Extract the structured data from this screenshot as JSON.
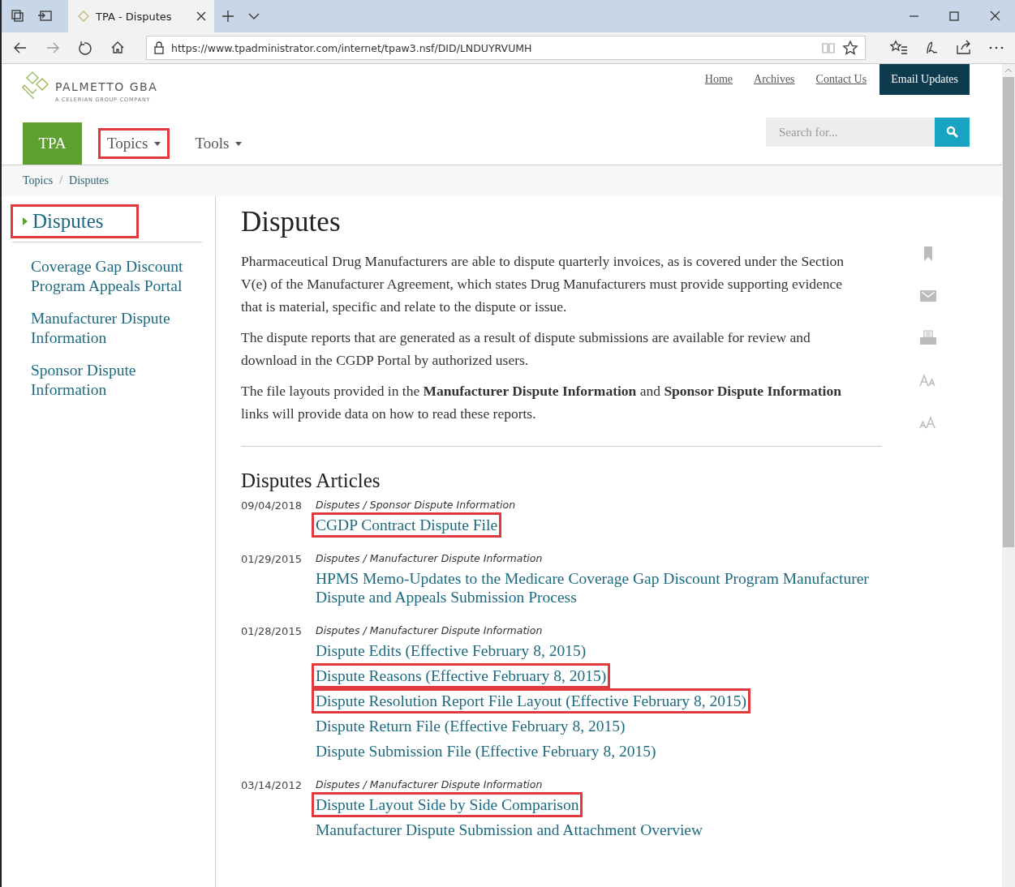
{
  "browser": {
    "tab_title": "TPA - Disputes",
    "url": "https://www.tpadministrator.com/internet/tpaw3.nsf/DID/LNDUYRVUMH"
  },
  "header": {
    "logo_name": "PALMETTO GBA",
    "logo_tagline": "A CELERIAN GROUP COMPANY",
    "utility_links": [
      "Home",
      "Archives",
      "Contact Us"
    ],
    "email_button": "Email Updates",
    "site_tab": "TPA",
    "nav": [
      {
        "label": "Topics",
        "highlighted": true
      },
      {
        "label": "Tools",
        "highlighted": false
      }
    ],
    "search": {
      "placeholder": "Search for..."
    }
  },
  "breadcrumb": [
    "Topics",
    "Disputes"
  ],
  "breadcrumb_separator": "/",
  "sidebar": {
    "heading": "Disputes",
    "highlighted": true,
    "links": [
      "Coverage Gap Discount Program Appeals Portal",
      "Manufacturer Dispute Information",
      "Sponsor Dispute Information"
    ]
  },
  "main": {
    "title": "Disputes",
    "paragraphs": [
      "Pharmaceutical Drug Manufacturers are able to dispute quarterly invoices, as is covered under the Section V(e) of the Manufacturer Agreement, which states Drug Manufacturers must provide supporting evidence that is material, specific and relate to the dispute or issue.",
      "The dispute reports that are generated as a result of dispute submissions are available for review and download in the CGDP Portal by authorized users.",
      "The file layouts provided in the **Manufacturer Dispute Information** and **Sponsor Dispute Information** links will provide data on how to read these reports."
    ],
    "articles_heading": "Disputes Articles",
    "articles": [
      {
        "date": "09/04/2018",
        "category": "Disputes / Sponsor Dispute Information",
        "links": [
          {
            "text": "CGDP Contract Dispute File",
            "highlighted": true
          }
        ]
      },
      {
        "date": "01/29/2015",
        "category": "Disputes / Manufacturer Dispute Information",
        "links": [
          {
            "text": "HPMS Memo-Updates to the Medicare Coverage Gap Discount Program Manufacturer Dispute and Appeals Submission Process",
            "highlighted": false
          }
        ]
      },
      {
        "date": "01/28/2015",
        "category": "Disputes / Manufacturer Dispute Information",
        "links": [
          {
            "text": "Dispute Edits (Effective February 8, 2015)",
            "highlighted": false
          },
          {
            "text": "Dispute Reasons (Effective February 8, 2015)",
            "highlighted": true
          },
          {
            "text": "Dispute Resolution Report File Layout (Effective February 8, 2015)",
            "highlighted": true
          },
          {
            "text": "Dispute Return File (Effective February 8, 2015)",
            "highlighted": false
          },
          {
            "text": "Dispute Submission File (Effective February 8, 2015)",
            "highlighted": false
          }
        ]
      },
      {
        "date": "03/14/2012",
        "category": "Disputes / Manufacturer Dispute Information",
        "links": [
          {
            "text": "Dispute Layout Side by Side Comparison",
            "highlighted": true
          },
          {
            "text": "Manufacturer Dispute Submission and Attachment Overview",
            "highlighted": false
          }
        ]
      }
    ]
  }
}
